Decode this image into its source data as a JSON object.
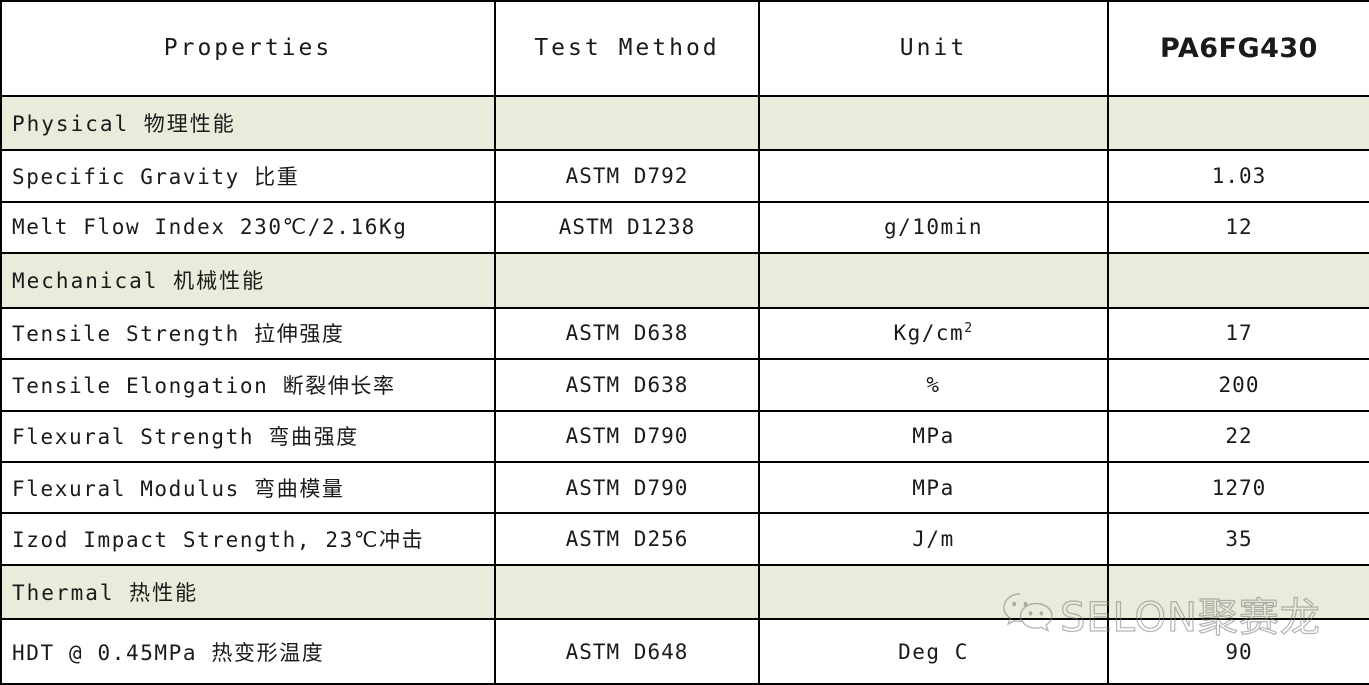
{
  "table": {
    "columns": [
      {
        "key": "properties",
        "label": "Properties"
      },
      {
        "key": "test_method",
        "label": "Test Method"
      },
      {
        "key": "unit",
        "label": "Unit"
      },
      {
        "key": "product",
        "label": "PA6FG430"
      }
    ],
    "sections": [
      {
        "label": "Physical 物理性能",
        "label_en": "Physical",
        "label_cn": "物理性能",
        "rows": [
          {
            "property_en": "Specific Gravity",
            "property_cn": "比重",
            "property": "Specific Gravity 比重",
            "test_method": "ASTM  D792",
            "unit": "",
            "value": "1.03"
          },
          {
            "property_en": "Melt Flow Index 230℃/2.16Kg",
            "property_cn": "",
            "property": "Melt Flow Index 230℃/2.16Kg",
            "test_method": "ASTM  D1238",
            "unit": "g/10min",
            "value": "12"
          }
        ]
      },
      {
        "label": "Mechanical 机械性能",
        "label_en": "Mechanical",
        "label_cn": "机械性能",
        "rows": [
          {
            "property_en": "Tensile Strength",
            "property_cn": "拉伸强度",
            "property": "Tensile Strength 拉伸强度",
            "test_method": "ASTM  D638",
            "unit": "Kg/cm2",
            "unit_base": "Kg/cm",
            "unit_sup": "2",
            "value": "17"
          },
          {
            "property_en": "Tensile Elongation",
            "property_cn": "断裂伸长率",
            "property": "Tensile Elongation 断裂伸长率",
            "test_method": "ASTM  D638",
            "unit": "%",
            "value": "200"
          },
          {
            "property_en": "Flexural Strength",
            "property_cn": "弯曲强度",
            "property": "Flexural Strength 弯曲强度",
            "test_method": "ASTM  D790",
            "unit": "MPa",
            "value": "22"
          },
          {
            "property_en": "Flexural Modulus",
            "property_cn": "弯曲模量",
            "property": "Flexural Modulus 弯曲模量",
            "test_method": "ASTM  D790",
            "unit": "MPa",
            "value": "1270"
          },
          {
            "property_en": "Izod Impact Strength, 23℃",
            "property_cn": "冲击",
            "property": "Izod Impact Strength, 23℃冲击",
            "test_method": "ASTM  D256",
            "unit": "J/m",
            "value": "35"
          }
        ]
      },
      {
        "label": "Thermal 热性能",
        "label_en": "Thermal",
        "label_cn": "热性能",
        "rows": [
          {
            "property_en": "HDT @ 0.45MPa",
            "property_cn": "热变形温度",
            "property": "HDT @ 0.45MPa  热变形温度",
            "test_method": "ASTM  D648",
            "unit": "Deg C",
            "value": "90"
          }
        ]
      }
    ]
  },
  "watermark": {
    "text": "SELON聚赛龙",
    "logo": "wechat-icon"
  },
  "colors": {
    "section_background": "#E8EDDB",
    "border": "#000000",
    "text": "#1A1A1A",
    "watermark_stroke": "#787878"
  }
}
